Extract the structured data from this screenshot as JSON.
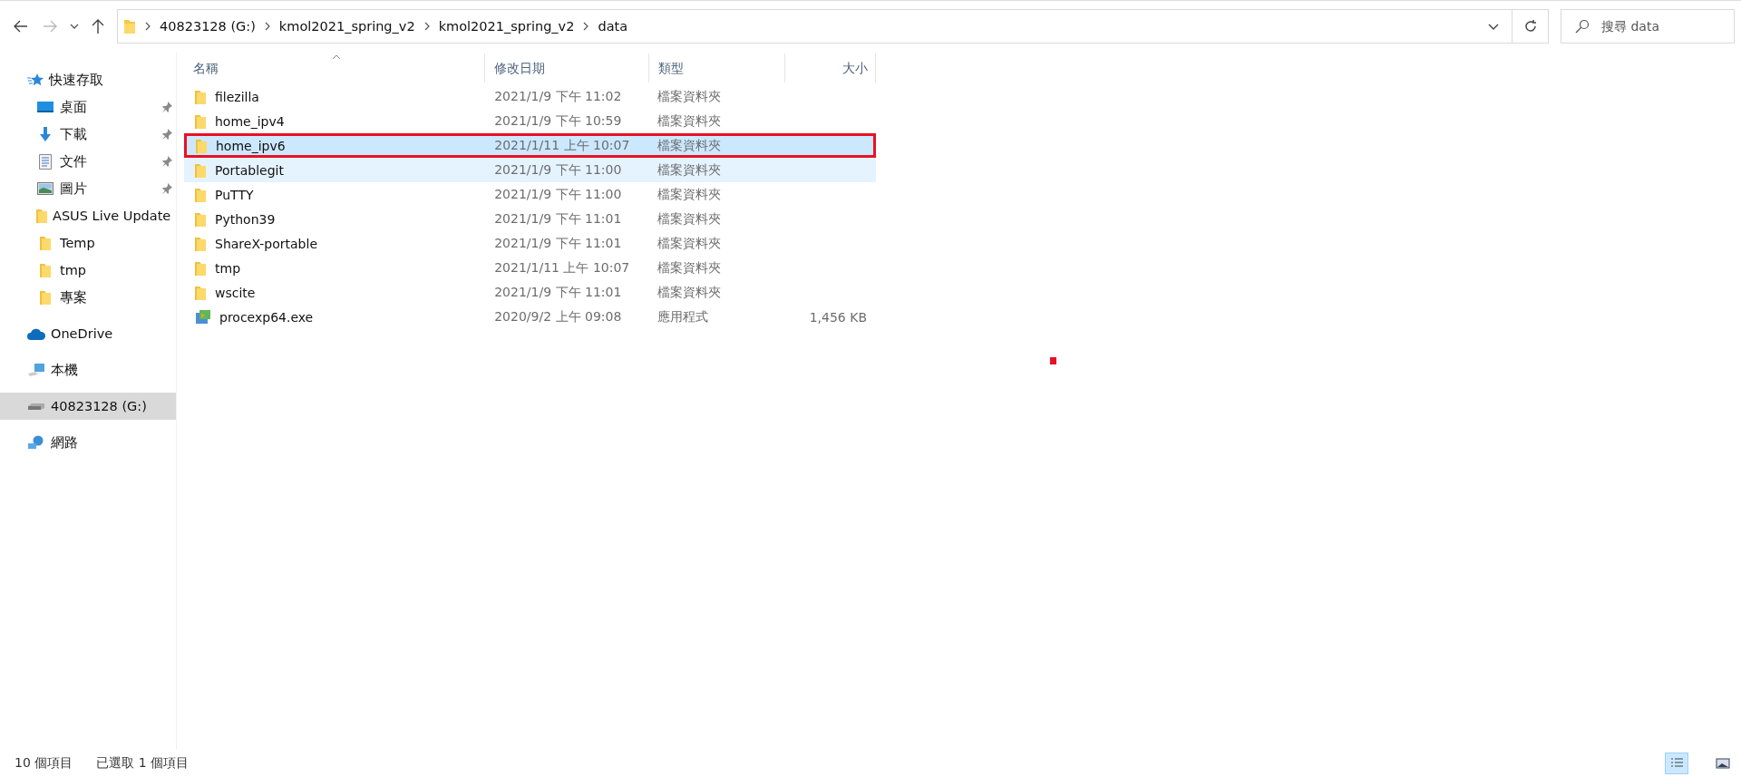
{
  "address_bar": {
    "path": [
      "40823128 (G:)",
      "kmol2021_spring_v2",
      "kmol2021_spring_v2",
      "data"
    ]
  },
  "search": {
    "placeholder": "搜尋 data"
  },
  "sidebar": {
    "items": [
      {
        "label": "快速存取",
        "kind": "star",
        "selected": false,
        "children": [
          {
            "label": "桌面",
            "kind": "desktop",
            "pinned": true
          },
          {
            "label": "下載",
            "kind": "download",
            "pinned": true
          },
          {
            "label": "文件",
            "kind": "document",
            "pinned": true
          },
          {
            "label": "圖片",
            "kind": "pictures",
            "pinned": true
          },
          {
            "label": "ASUS Live Update",
            "kind": "folder",
            "pinned": false
          },
          {
            "label": "Temp",
            "kind": "folder",
            "pinned": false
          },
          {
            "label": "tmp",
            "kind": "folder",
            "pinned": false
          },
          {
            "label": "專案",
            "kind": "folder",
            "pinned": false
          }
        ]
      },
      {
        "label": "OneDrive",
        "kind": "cloud",
        "selected": false
      },
      {
        "label": "本機",
        "kind": "pc",
        "selected": false
      },
      {
        "label": "40823128 (G:)",
        "kind": "drive",
        "selected": true
      },
      {
        "label": "網路",
        "kind": "network",
        "selected": false
      }
    ]
  },
  "table": {
    "columns": [
      "名稱",
      "修改日期",
      "類型",
      "大小"
    ],
    "rows": [
      {
        "name": "filezilla",
        "kind": "folder",
        "date": "2021/1/9 下午 11:02",
        "type": "檔案資料夾",
        "selected": false,
        "hovered": false,
        "outlined": false
      },
      {
        "name": "home_ipv4",
        "kind": "folder",
        "date": "2021/1/9 下午 10:59",
        "type": "檔案資料夾",
        "selected": false,
        "hovered": false,
        "outlined": false
      },
      {
        "name": "home_ipv6",
        "kind": "folder",
        "date": "2021/1/11 上午 10:07",
        "type": "檔案資料夾",
        "selected": true,
        "hovered": false,
        "outlined": true
      },
      {
        "name": "Portablegit",
        "kind": "folder",
        "date": "2021/1/9 下午 11:00",
        "type": "檔案資料夾",
        "selected": false,
        "hovered": true,
        "outlined": false
      },
      {
        "name": "PuTTY",
        "kind": "folder",
        "date": "2021/1/9 下午 11:00",
        "type": "檔案資料夾",
        "selected": false,
        "hovered": false,
        "outlined": false
      },
      {
        "name": "Python39",
        "kind": "folder",
        "date": "2021/1/9 下午 11:01",
        "type": "檔案資料夾",
        "selected": false,
        "hovered": false,
        "outlined": false
      },
      {
        "name": "ShareX-portable",
        "kind": "folder",
        "date": "2021/1/9 下午 11:01",
        "type": "檔案資料夾",
        "selected": false,
        "hovered": false,
        "outlined": false
      },
      {
        "name": "tmp",
        "kind": "folder",
        "date": "2021/1/11 上午 10:07",
        "type": "檔案資料夾",
        "selected": false,
        "hovered": false,
        "outlined": false
      },
      {
        "name": "wscite",
        "kind": "folder",
        "date": "2021/1/9 下午 11:01",
        "type": "檔案資料夾",
        "selected": false,
        "hovered": false,
        "outlined": false
      },
      {
        "name": "procexp64.exe",
        "kind": "app",
        "date": "2020/9/2 上午 09:08",
        "type": "應用程式",
        "size": "1,456 KB",
        "selected": false,
        "hovered": false,
        "outlined": false
      }
    ]
  },
  "status_bar": {
    "count": "10 個項目",
    "selection": "已選取 1 個項目"
  }
}
